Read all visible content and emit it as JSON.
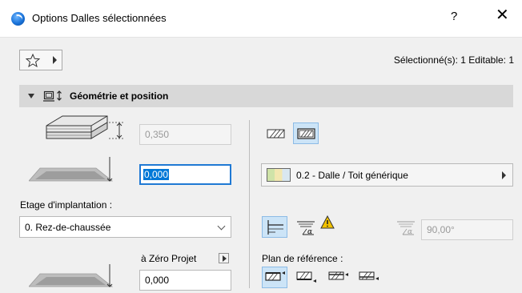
{
  "window": {
    "title": "Options Dalles sélectionnées",
    "help_label": "?",
    "close_label": "✕"
  },
  "toolbar": {
    "selection_status": "Sélectionné(s): 1 Editable: 1"
  },
  "section": {
    "title": "Géométrie et position"
  },
  "geometry": {
    "thickness": "0,350",
    "offset": "0,000",
    "home_story_label": "Etage d'implantation :",
    "home_story_value": "0. Rez-de-chaussée",
    "project_zero_label": "à Zéro Projet",
    "project_zero_value": "0,000"
  },
  "structure": {
    "material": "0.2 - Dalle / Toit générique",
    "angle": "90,00°",
    "reference_plane_label": "Plan de référence :"
  },
  "colors": {
    "accent": "#0078d7",
    "toggle_on_bg": "#cce4f7",
    "header_bg": "#d8d8d8",
    "warning": "#f2c200"
  }
}
